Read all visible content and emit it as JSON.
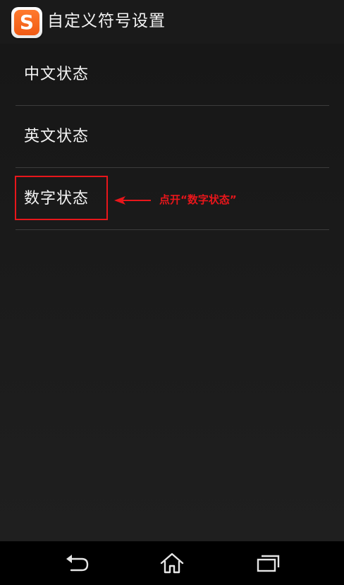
{
  "app_bar": {
    "icon": "sogou-logo-icon",
    "icon_letter": "S",
    "title": "自定义符号设置",
    "brand_color": "#f05a14"
  },
  "list": {
    "items": [
      {
        "label": "中文状态"
      },
      {
        "label": "英文状态"
      },
      {
        "label": "数字状态"
      }
    ]
  },
  "annotation": {
    "text": "点开“数字状态”",
    "color": "#e8161b",
    "target": "数字状态"
  },
  "nav_bar": {
    "back": "back-icon",
    "home": "home-icon",
    "recents": "recents-icon"
  }
}
